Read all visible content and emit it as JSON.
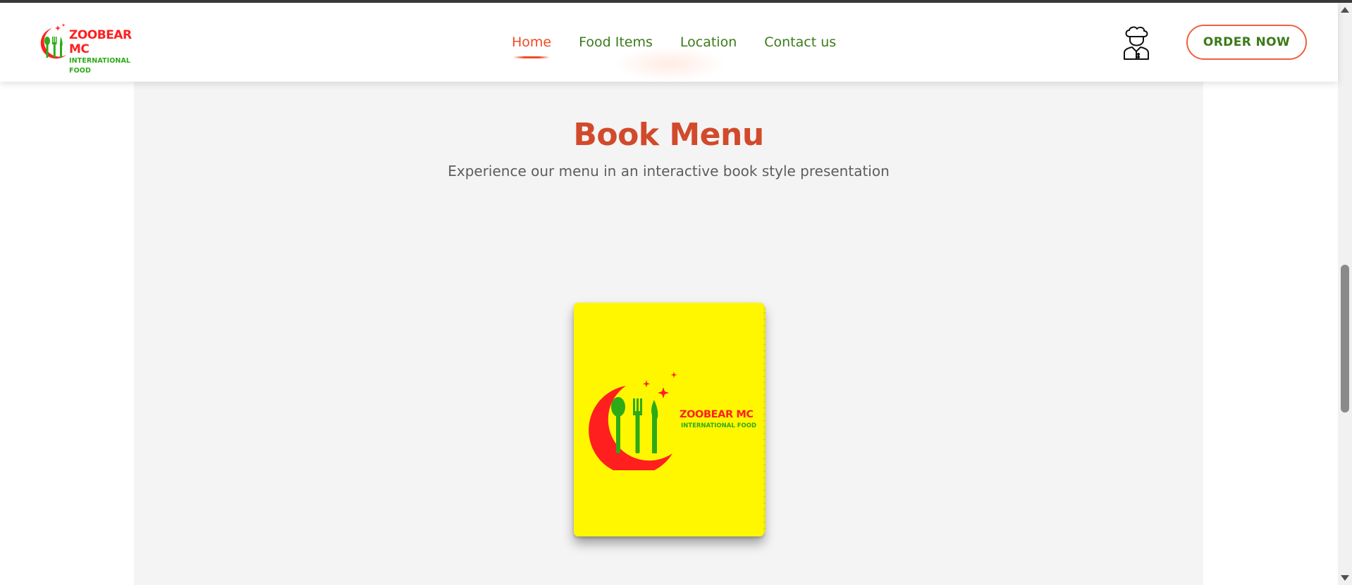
{
  "brand": {
    "name": "ZOOBEAR MC",
    "tagline": "INTERNATIONAL FOOD",
    "colors": {
      "red": "#ff1f1f",
      "green": "#2eaa16",
      "accent": "#f24a24",
      "nav_green": "#3b7a1a"
    }
  },
  "nav": {
    "items": [
      {
        "label": "Home",
        "active": true
      },
      {
        "label": "Food Items",
        "active": false
      },
      {
        "label": "Location",
        "active": false
      },
      {
        "label": "Contact us",
        "active": false
      }
    ]
  },
  "header": {
    "chef_icon": "chef-icon",
    "order_label": "ORDER NOW"
  },
  "main": {
    "title": "Book Menu",
    "subtitle": "Experience our menu in an interactive book style presentation",
    "book": {
      "cover_color": "#fff700"
    }
  }
}
